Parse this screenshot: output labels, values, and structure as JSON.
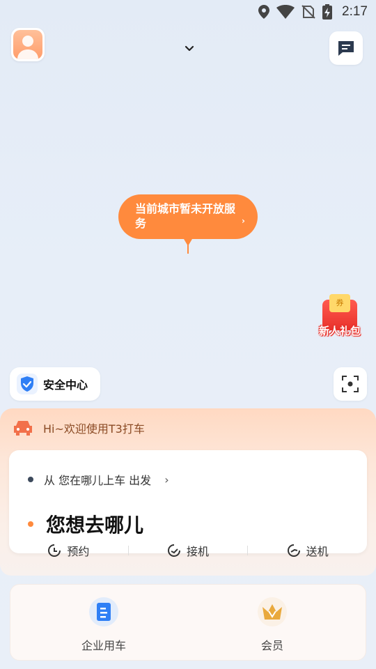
{
  "status_bar": {
    "time": "2:17",
    "icons": [
      "location-icon",
      "wifi-icon",
      "no-sim-icon",
      "battery-charging-icon"
    ]
  },
  "header": {
    "avatar_icon": "user-avatar-icon",
    "city_selector_icon": "chevron-down-icon",
    "message_icon": "message-icon"
  },
  "map": {
    "notice_text": "当前城市暂未开放服务",
    "notice_arrow": "›"
  },
  "promo": {
    "ticket_text": "券",
    "label": "新人礼包"
  },
  "safety": {
    "label": "安全中心"
  },
  "panel": {
    "welcome_text": "Hi~欢迎使用T3打车",
    "from_text": "从 您在哪儿上车 出发",
    "from_chevron": "›",
    "to_placeholder": "您想去哪儿",
    "quick_actions": [
      {
        "label": "预约",
        "icon": "clock-icon"
      },
      {
        "label": "接机",
        "icon": "plane-arrive-icon"
      },
      {
        "label": "送机",
        "icon": "plane-depart-icon"
      }
    ]
  },
  "bottom_nav": {
    "items": [
      {
        "label": "企业用车",
        "icon": "enterprise-icon"
      },
      {
        "label": "会员",
        "icon": "vip-crown-icon"
      }
    ]
  },
  "colors": {
    "accent": "#ff8a3d",
    "shield_blue": "#2f7ff5",
    "from_dot": "#3d4a5c",
    "to_dot": "#ff8a3d"
  }
}
